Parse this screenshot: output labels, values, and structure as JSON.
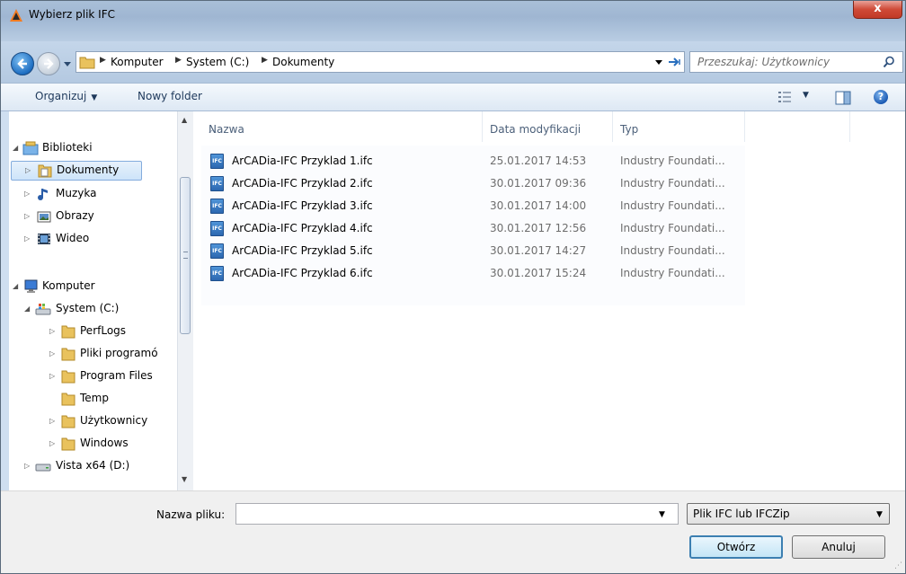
{
  "window": {
    "title": "Wybierz plik IFC",
    "close_label": "x"
  },
  "address": {
    "crumbs": [
      "Komputer",
      "System (C:)",
      "Dokumenty"
    ],
    "search_placeholder": "Przeszukaj: Użytkownicy"
  },
  "commands": {
    "organize_label": "Organizuj",
    "new_folder_label": "Nowy folder"
  },
  "nav": {
    "items": [
      {
        "label": "Biblioteki",
        "icon": "library-icon"
      },
      {
        "label": "Dokumenty",
        "icon": "documents-folder-icon"
      },
      {
        "label": "Muzyka",
        "icon": "music-icon"
      },
      {
        "label": "Obrazy",
        "icon": "pictures-icon"
      },
      {
        "label": "Wideo",
        "icon": "video-icon"
      },
      {
        "label": "Komputer",
        "icon": "computer-icon"
      },
      {
        "label": "System (C:)",
        "icon": "system-drive-icon"
      },
      {
        "label": "PerfLogs",
        "icon": "folder-icon"
      },
      {
        "label": "Pliki programó",
        "icon": "folder-icon"
      },
      {
        "label": "Program Files",
        "icon": "folder-icon"
      },
      {
        "label": "Temp",
        "icon": "folder-icon"
      },
      {
        "label": "Użytkownicy",
        "icon": "folder-icon"
      },
      {
        "label": "Windows",
        "icon": "folder-icon"
      },
      {
        "label": "Vista x64 (D:)",
        "icon": "drive-icon"
      }
    ]
  },
  "columns": {
    "name": "Nazwa",
    "date": "Data modyfikacji",
    "type": "Typ"
  },
  "files": [
    {
      "name": "ArCADia-IFC Przyklad 1.ifc",
      "date": "25.01.2017 14:53",
      "type": "Industry Foundati..."
    },
    {
      "name": "ArCADia-IFC Przyklad 2.ifc",
      "date": "30.01.2017 09:36",
      "type": "Industry Foundati..."
    },
    {
      "name": "ArCADia-IFC Przyklad 3.ifc",
      "date": "30.01.2017 14:00",
      "type": "Industry Foundati..."
    },
    {
      "name": "ArCADia-IFC Przyklad 4.ifc",
      "date": "30.01.2017 12:56",
      "type": "Industry Foundati..."
    },
    {
      "name": "ArCADia-IFC Przyklad 5.ifc",
      "date": "30.01.2017 14:27",
      "type": "Industry Foundati..."
    },
    {
      "name": "ArCADia-IFC Przyklad 6.ifc",
      "date": "30.01.2017 15:24",
      "type": "Industry Foundati..."
    }
  ],
  "file_icon_text": "IFC",
  "bottom": {
    "filename_label": "Nazwa pliku:",
    "filename_value": "",
    "filter_value": "Plik IFC lub IFCZip",
    "open_label": "Otwórz",
    "cancel_label": "Anuluj"
  },
  "colors": {
    "selection": "#cde4fa",
    "accent": "#3c7fb1",
    "close": "#c13a27"
  }
}
